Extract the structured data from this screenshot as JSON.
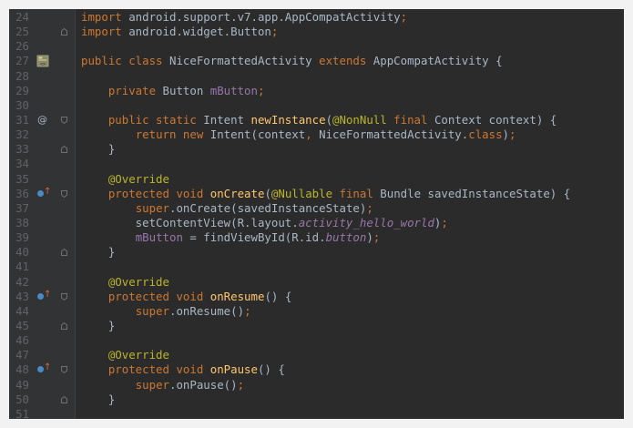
{
  "editor": {
    "lines": [
      {
        "num": "24",
        "fold": "none",
        "marker": "none",
        "tokens": [
          [
            "kw",
            "import "
          ],
          [
            "cls",
            "android.support.v7.app.AppCompatActivity"
          ],
          [
            "punct",
            ";"
          ]
        ]
      },
      {
        "num": "25",
        "fold": "end",
        "marker": "none",
        "tokens": [
          [
            "kw",
            "import "
          ],
          [
            "cls",
            "android.widget.Button"
          ],
          [
            "punct",
            ";"
          ]
        ]
      },
      {
        "num": "26",
        "fold": "none",
        "marker": "none",
        "tokens": []
      },
      {
        "num": "27",
        "fold": "none",
        "marker": "layout",
        "tokens": [
          [
            "kw",
            "public class "
          ],
          [
            "cls",
            "NiceFormattedActivity "
          ],
          [
            "kw",
            "extends "
          ],
          [
            "cls",
            "AppCompatActivity {"
          ]
        ]
      },
      {
        "num": "28",
        "fold": "none",
        "marker": "none",
        "tokens": []
      },
      {
        "num": "29",
        "fold": "none",
        "marker": "none",
        "tokens": [
          [
            "cls",
            "    "
          ],
          [
            "kw",
            "private "
          ],
          [
            "cls",
            "Button "
          ],
          [
            "field",
            "mButton"
          ],
          [
            "punct",
            ";"
          ]
        ]
      },
      {
        "num": "30",
        "fold": "none",
        "marker": "none",
        "tokens": []
      },
      {
        "num": "31",
        "fold": "start",
        "marker": "at",
        "tokens": [
          [
            "cls",
            "    "
          ],
          [
            "kw",
            "public static "
          ],
          [
            "cls",
            "Intent "
          ],
          [
            "fn",
            "newInstance"
          ],
          [
            "cls",
            "("
          ],
          [
            "ann",
            "@NonNull "
          ],
          [
            "kw",
            "final "
          ],
          [
            "cls",
            "Context context) {"
          ]
        ]
      },
      {
        "num": "32",
        "fold": "none",
        "marker": "none",
        "tokens": [
          [
            "cls",
            "        "
          ],
          [
            "kw",
            "return new "
          ],
          [
            "cls",
            "Intent(context"
          ],
          [
            "punct",
            ", "
          ],
          [
            "cls",
            "NiceFormattedActivity."
          ],
          [
            "kw",
            "class"
          ],
          [
            "cls",
            ")"
          ],
          [
            "punct",
            ";"
          ]
        ]
      },
      {
        "num": "33",
        "fold": "end",
        "marker": "none",
        "tokens": [
          [
            "cls",
            "    }"
          ]
        ]
      },
      {
        "num": "34",
        "fold": "none",
        "marker": "none",
        "tokens": []
      },
      {
        "num": "35",
        "fold": "none",
        "marker": "none",
        "tokens": [
          [
            "cls",
            "    "
          ],
          [
            "ann",
            "@Override"
          ]
        ]
      },
      {
        "num": "36",
        "fold": "start",
        "marker": "override",
        "tokens": [
          [
            "cls",
            "    "
          ],
          [
            "kw",
            "protected void "
          ],
          [
            "fn",
            "onCreate"
          ],
          [
            "cls",
            "("
          ],
          [
            "ann",
            "@Nullable "
          ],
          [
            "kw",
            "final "
          ],
          [
            "cls",
            "Bundle savedInstanceState) {"
          ]
        ]
      },
      {
        "num": "37",
        "fold": "none",
        "marker": "none",
        "tokens": [
          [
            "cls",
            "        "
          ],
          [
            "kw",
            "super"
          ],
          [
            "cls",
            ".onCreate(savedInstanceState)"
          ],
          [
            "punct",
            ";"
          ]
        ]
      },
      {
        "num": "38",
        "fold": "none",
        "marker": "none",
        "tokens": [
          [
            "cls",
            "        setContentView(R.layout."
          ],
          [
            "ital",
            "activity_hello_world"
          ],
          [
            "cls",
            ")"
          ],
          [
            "punct",
            ";"
          ]
        ]
      },
      {
        "num": "39",
        "fold": "none",
        "marker": "none",
        "tokens": [
          [
            "cls",
            "        "
          ],
          [
            "field",
            "mButton"
          ],
          [
            "cls",
            " = findViewById(R.id."
          ],
          [
            "ital",
            "button"
          ],
          [
            "cls",
            ")"
          ],
          [
            "punct",
            ";"
          ]
        ]
      },
      {
        "num": "40",
        "fold": "end",
        "marker": "none",
        "tokens": [
          [
            "cls",
            "    }"
          ]
        ]
      },
      {
        "num": "41",
        "fold": "none",
        "marker": "none",
        "tokens": []
      },
      {
        "num": "42",
        "fold": "none",
        "marker": "none",
        "tokens": [
          [
            "cls",
            "    "
          ],
          [
            "ann",
            "@Override"
          ]
        ]
      },
      {
        "num": "43",
        "fold": "start",
        "marker": "override",
        "tokens": [
          [
            "cls",
            "    "
          ],
          [
            "kw",
            "protected void "
          ],
          [
            "fn",
            "onResume"
          ],
          [
            "cls",
            "() {"
          ]
        ]
      },
      {
        "num": "44",
        "fold": "none",
        "marker": "none",
        "tokens": [
          [
            "cls",
            "        "
          ],
          [
            "kw",
            "super"
          ],
          [
            "cls",
            ".onResume()"
          ],
          [
            "punct",
            ";"
          ]
        ]
      },
      {
        "num": "45",
        "fold": "end",
        "marker": "none",
        "tokens": [
          [
            "cls",
            "    }"
          ]
        ]
      },
      {
        "num": "46",
        "fold": "none",
        "marker": "none",
        "tokens": []
      },
      {
        "num": "47",
        "fold": "none",
        "marker": "none",
        "tokens": [
          [
            "cls",
            "    "
          ],
          [
            "ann",
            "@Override"
          ]
        ]
      },
      {
        "num": "48",
        "fold": "start",
        "marker": "override",
        "tokens": [
          [
            "cls",
            "    "
          ],
          [
            "kw",
            "protected void "
          ],
          [
            "fn",
            "onPause"
          ],
          [
            "cls",
            "() {"
          ]
        ]
      },
      {
        "num": "49",
        "fold": "none",
        "marker": "none",
        "tokens": [
          [
            "cls",
            "        "
          ],
          [
            "kw",
            "super"
          ],
          [
            "cls",
            ".onPause()"
          ],
          [
            "punct",
            ";"
          ]
        ]
      },
      {
        "num": "50",
        "fold": "end",
        "marker": "none",
        "tokens": [
          [
            "cls",
            "    }"
          ]
        ]
      },
      {
        "num": "51",
        "fold": "none",
        "marker": "none",
        "tokens": []
      }
    ]
  },
  "markers": {
    "at_symbol": "@",
    "override_arrow": "↑"
  },
  "colors": {
    "background": "#2b2b2b",
    "gutter": "#313335",
    "line_number": "#606366",
    "keyword": "#cc7832",
    "annotation": "#bbb529",
    "method": "#ffc66d",
    "field": "#9876aa",
    "text": "#a9b7c6"
  },
  "icons": {
    "layout": "android-layout-icon",
    "override": "override-method-icon",
    "implements": "at-annotation-icon",
    "fold_start": "fold-start-icon",
    "fold_end": "fold-end-icon"
  }
}
